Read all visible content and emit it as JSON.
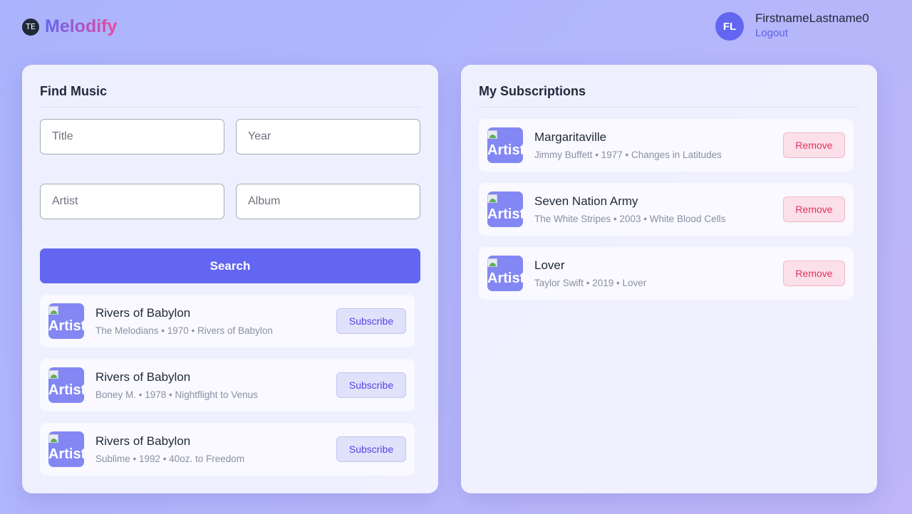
{
  "header": {
    "logo_icon": "TE",
    "brand": "Melodify",
    "user": {
      "initials": "FL",
      "name": "FirstnameLastname0",
      "logout_label": "Logout"
    }
  },
  "find": {
    "title": "Find Music",
    "placeholders": {
      "title": "Title",
      "year": "Year",
      "artist": "Artist",
      "album": "Album"
    },
    "search_label": "Search",
    "results": [
      {
        "title": "Rivers of Babylon",
        "meta": "The Melodians • 1970 • Rivers of Babylon",
        "thumb": "Artist",
        "action": "Subscribe"
      },
      {
        "title": "Rivers of Babylon",
        "meta": "Boney M. • 1978 • Nightflight to Venus",
        "thumb": "Artist",
        "action": "Subscribe"
      },
      {
        "title": "Rivers of Babylon",
        "meta": "Sublime • 1992 • 40oz. to Freedom",
        "thumb": "Artist",
        "action": "Subscribe"
      }
    ]
  },
  "subscriptions": {
    "title": "My Subscriptions",
    "items": [
      {
        "title": "Margaritaville",
        "meta": "Jimmy Buffett • 1977 • Changes in Latitudes",
        "thumb": "Artist",
        "action": "Remove"
      },
      {
        "title": "Seven Nation Army",
        "meta": "The White Stripes • 2003 • White Blood Cells",
        "thumb": "Artist",
        "action": "Remove"
      },
      {
        "title": "Lover",
        "meta": "Taylor Swift • 2019 • Lover",
        "thumb": "Artist",
        "action": "Remove"
      }
    ]
  },
  "colors": {
    "accent": "#6366f1",
    "remove": "#e1335f",
    "background": "#b1b6fb"
  },
  "icons": {
    "logo": "brand-logo-icon",
    "thumbnail": "broken-image-icon"
  }
}
